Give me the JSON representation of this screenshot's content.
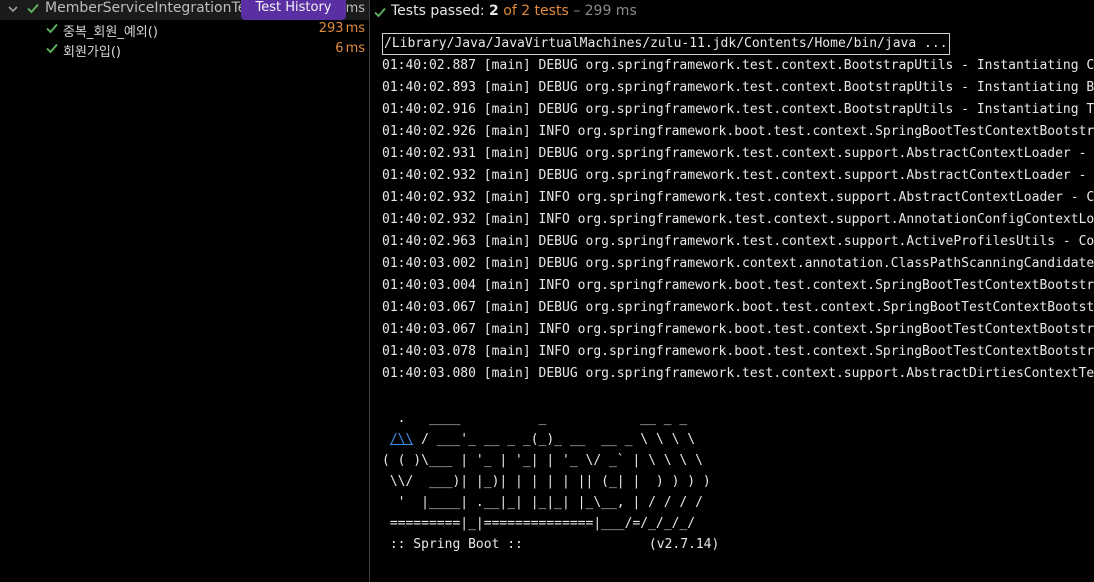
{
  "tree": {
    "root": {
      "label": "MemberServiceIntegrationTest",
      "time_unit": "ms"
    },
    "tooltip": "Test History",
    "items": [
      {
        "label": "중복_회원_예외()",
        "time_num": "293",
        "time_unit": "ms"
      },
      {
        "label": "회원가입()",
        "time_num": "6",
        "time_unit": "ms"
      }
    ]
  },
  "status": {
    "passed_label": "Tests passed:",
    "passed_count": "2",
    "of_text": "of 2 tests",
    "duration": "– 299 ms"
  },
  "console": {
    "command": "/Library/Java/JavaVirtualMachines/zulu-11.jdk/Contents/Home/bin/java ...",
    "log_lines": [
      "01:40:02.887 [main] DEBUG org.springframework.test.context.BootstrapUtils - Instantiating Ca",
      "01:40:02.893 [main] DEBUG org.springframework.test.context.BootstrapUtils - Instantiating Bo",
      "01:40:02.916 [main] DEBUG org.springframework.test.context.BootstrapUtils - Instantiating Te",
      "01:40:02.926 [main] INFO org.springframework.boot.test.context.SpringBootTestContextBootstra",
      "01:40:02.931 [main] DEBUG org.springframework.test.context.support.AbstractContextLoader - D",
      "01:40:02.932 [main] DEBUG org.springframework.test.context.support.AbstractContextLoader - D",
      "01:40:02.932 [main] INFO org.springframework.test.context.support.AbstractContextLoader - Co",
      "01:40:02.932 [main] INFO org.springframework.test.context.support.AnnotationConfigContextLoa",
      "01:40:02.963 [main] DEBUG org.springframework.test.context.support.ActiveProfilesUtils - Cou",
      "01:40:03.002 [main] DEBUG org.springframework.context.annotation.ClassPathScanningCandidateC",
      "01:40:03.004 [main] INFO org.springframework.boot.test.context.SpringBootTestContextBootstra",
      "01:40:03.067 [main] DEBUG org.springframework.boot.test.context.SpringBootTestContextBootstr",
      "01:40:03.067 [main] INFO org.springframework.boot.test.context.SpringBootTestContextBootstra",
      "01:40:03.078 [main] INFO org.springframework.boot.test.context.SpringBootTestContextBootstra",
      "01:40:03.080 [main] DEBUG org.springframework.test.context.support.AbstractDirtiesContextTes"
    ],
    "banner": {
      "line1": "  .   ____          _            __ _ _",
      "line2_link": "/\\\\",
      "line2_rest": " / ___'_ __ _ _(_)_ __  __ _ \\ \\ \\ \\",
      "line3": "( ( )\\___ | '_ | '_| | '_ \\/ _` | \\ \\ \\ \\",
      "line4": " \\\\/  ___)| |_)| | | | | || (_| |  ) ) ) )",
      "line5": "  '  |____| .__|_| |_|_| |_\\__, | / / / /",
      "line6": " =========|_|==============|___/=/_/_/_/",
      "spring_label": " :: Spring Boot ::",
      "spring_version": "(v2.7.14)"
    }
  }
}
